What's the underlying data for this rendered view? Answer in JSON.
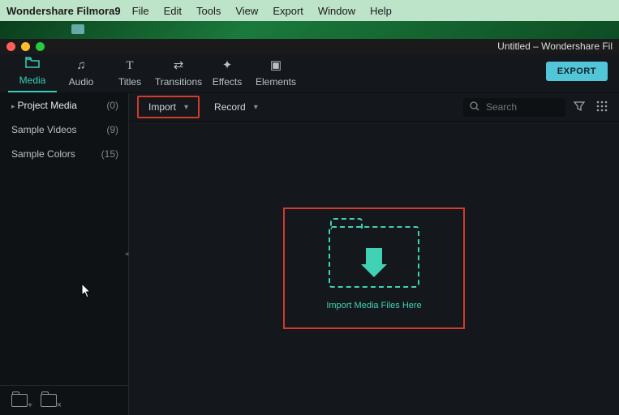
{
  "menubar": {
    "app": "Wondershare Filmora9",
    "items": [
      "File",
      "Edit",
      "Tools",
      "View",
      "Export",
      "Window",
      "Help"
    ]
  },
  "window": {
    "title": "Untitled – Wondershare Fil"
  },
  "tabs": {
    "media": {
      "label": "Media"
    },
    "audio": {
      "label": "Audio"
    },
    "titles": {
      "label": "Titles"
    },
    "transitions": {
      "label": "Transitions"
    },
    "effects": {
      "label": "Effects"
    },
    "elements": {
      "label": "Elements"
    }
  },
  "export_button": "EXPORT",
  "sidebar": {
    "items": [
      {
        "label": "Project Media",
        "count": "(0)"
      },
      {
        "label": "Sample Videos",
        "count": "(9)"
      },
      {
        "label": "Sample Colors",
        "count": "(15)"
      }
    ]
  },
  "toolbar": {
    "import": "Import",
    "record": "Record",
    "search_placeholder": "Search"
  },
  "dropzone": {
    "text": "Import Media Files Here"
  }
}
